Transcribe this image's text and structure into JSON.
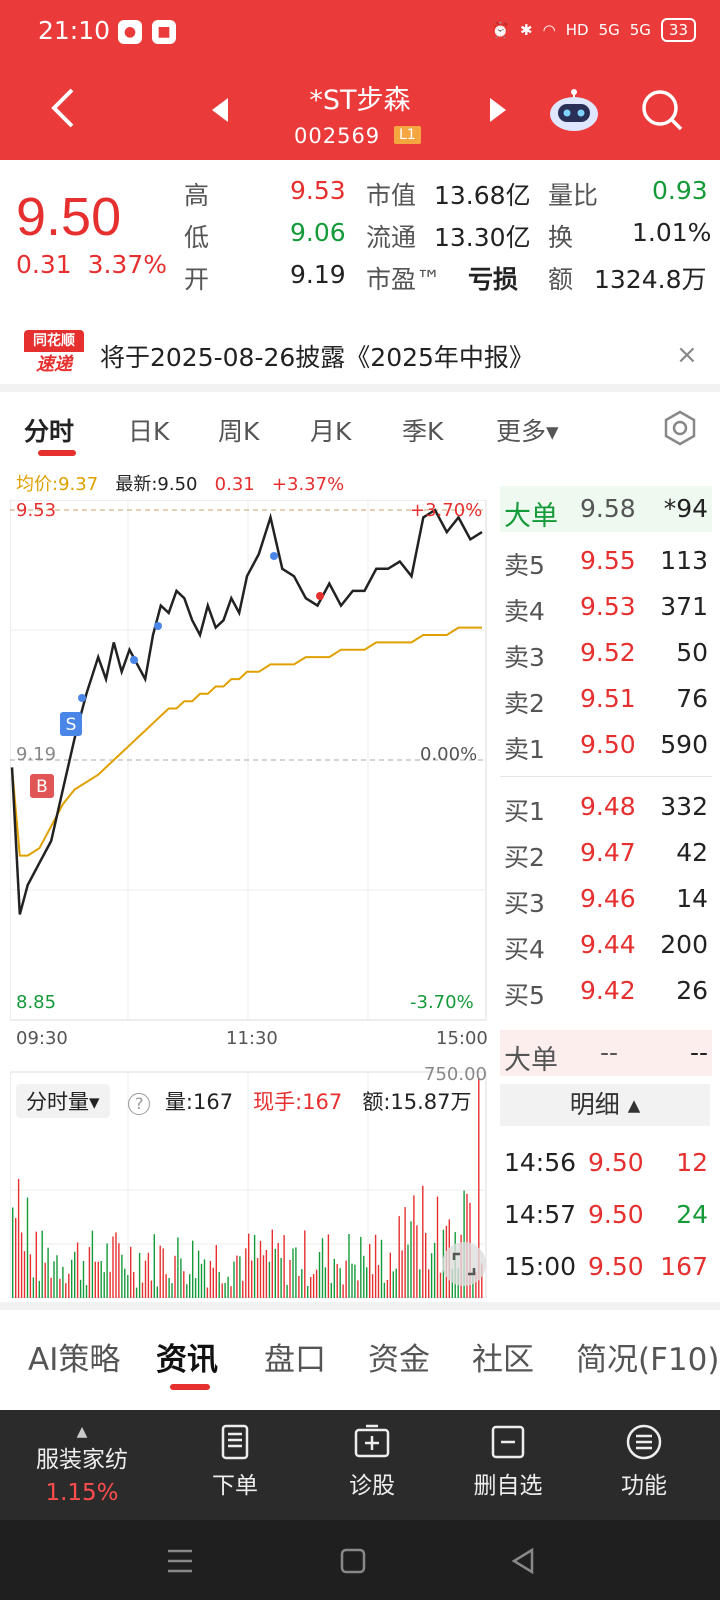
{
  "status": {
    "time": "21:10",
    "network": "5G",
    "hd": "HD",
    "battery": "33"
  },
  "header": {
    "title": "*ST步森",
    "code": "002569",
    "level": "L1"
  },
  "quote": {
    "price": "9.50",
    "change": "0.31",
    "change_pct": "3.37%",
    "high_label": "高",
    "high": "9.53",
    "low_label": "低",
    "low": "9.06",
    "open_label": "开",
    "open": "9.19",
    "mcap_label": "市值",
    "mcap": "13.68亿",
    "float_label": "流通",
    "float": "13.30亿",
    "pe_label": "市盈™",
    "pe": "亏损",
    "vr_label": "量比",
    "vr": "0.93",
    "turnover_label": "换",
    "turnover": "1.01%",
    "amount_label": "额",
    "amount": "1324.8万"
  },
  "notice": {
    "logo_top": "同花顺",
    "logo_bottom": "速递",
    "text": "将于2025-08-26披露《2025年中报》",
    "close": "×"
  },
  "chart_tabs": [
    {
      "label": "分时"
    },
    {
      "label": "日K"
    },
    {
      "label": "周K"
    },
    {
      "label": "月K"
    },
    {
      "label": "季K"
    },
    {
      "label": "更多▾"
    }
  ],
  "legend": {
    "avg": "均价:9.37",
    "latest": "最新:9.50",
    "chg": "0.31",
    "pct": "+3.37%"
  },
  "axes": {
    "top_price": "9.53",
    "top_pct": "+3.70%",
    "mid_price": "9.19",
    "mid_pct": "0.00%",
    "bot_price": "8.85",
    "bot_pct": "-3.70%",
    "t_start": "09:30",
    "t_mid": "11:30",
    "t_end": "15:00",
    "marker_b": "B",
    "marker_s": "S"
  },
  "chart_data": {
    "type": "line",
    "x_label_ticks": [
      "09:30",
      "11:30",
      "15:00"
    ],
    "ylim": [
      8.85,
      9.53
    ],
    "prev_close": 9.19,
    "series": [],
    "price_points_t": [
      0,
      4,
      8,
      14,
      20,
      26,
      32,
      38,
      44,
      48,
      52,
      56,
      60,
      64,
      68,
      72,
      76,
      80,
      84,
      88,
      92,
      96,
      100,
      104,
      108,
      112,
      116,
      120,
      126,
      132,
      138,
      144,
      150,
      156,
      162,
      168,
      174,
      180,
      186,
      192,
      198,
      204,
      210,
      216,
      222,
      228,
      234,
      240
    ],
    "price_points_y": [
      9.18,
      8.98,
      9.02,
      9.05,
      9.08,
      9.15,
      9.22,
      9.28,
      9.33,
      9.3,
      9.35,
      9.31,
      9.34,
      9.32,
      9.3,
      9.36,
      9.4,
      9.39,
      9.42,
      9.41,
      9.38,
      9.36,
      9.4,
      9.37,
      9.38,
      9.41,
      9.39,
      9.44,
      9.47,
      9.52,
      9.45,
      9.44,
      9.41,
      9.4,
      9.43,
      9.4,
      9.42,
      9.42,
      9.45,
      9.45,
      9.46,
      9.44,
      9.52,
      9.53,
      9.5,
      9.52,
      9.49,
      9.5
    ],
    "avg_points_y": [
      9.18,
      9.06,
      9.06,
      9.07,
      9.1,
      9.13,
      9.15,
      9.16,
      9.17,
      9.18,
      9.19,
      9.2,
      9.21,
      9.22,
      9.23,
      9.24,
      9.25,
      9.26,
      9.26,
      9.27,
      9.27,
      9.28,
      9.28,
      9.29,
      9.29,
      9.3,
      9.3,
      9.31,
      9.31,
      9.32,
      9.32,
      9.32,
      9.33,
      9.33,
      9.33,
      9.34,
      9.34,
      9.34,
      9.35,
      9.35,
      9.35,
      9.35,
      9.36,
      9.36,
      9.36,
      9.37,
      9.37,
      9.37
    ],
    "volume_max": 750
  },
  "book": {
    "big_label": "大单",
    "big_price": "9.58",
    "big_vol": "*94",
    "asks": [
      {
        "name": "卖5",
        "price": "9.55",
        "vol": "113"
      },
      {
        "name": "卖4",
        "price": "9.53",
        "vol": "371"
      },
      {
        "name": "卖3",
        "price": "9.52",
        "vol": "50"
      },
      {
        "name": "卖2",
        "price": "9.51",
        "vol": "76"
      },
      {
        "name": "卖1",
        "price": "9.50",
        "vol": "590"
      }
    ],
    "bids": [
      {
        "name": "买1",
        "price": "9.48",
        "vol": "332"
      },
      {
        "name": "买2",
        "price": "9.47",
        "vol": "42"
      },
      {
        "name": "买3",
        "price": "9.46",
        "vol": "14"
      },
      {
        "name": "买4",
        "price": "9.44",
        "vol": "200"
      },
      {
        "name": "买5",
        "price": "9.42",
        "vol": "26"
      }
    ],
    "big2_label": "大单",
    "big2_price": "--",
    "big2_vol": "--",
    "detail_label": "明细 ▴",
    "ticks": [
      {
        "time": "14:56",
        "price": "9.50",
        "vol": "12",
        "color": "#e5302f"
      },
      {
        "time": "14:57",
        "price": "9.50",
        "vol": "24",
        "color": "#159a3a"
      },
      {
        "time": "15:00",
        "price": "9.50",
        "vol": "167",
        "color": "#e5302f"
      }
    ]
  },
  "volume": {
    "selector": "分时量▾",
    "help": "?",
    "vol": "量:167",
    "now": "现手:167",
    "amount": "额:15.87万",
    "max_label": "750.00"
  },
  "info_tabs": [
    {
      "label": "AI策略"
    },
    {
      "label": "资讯"
    },
    {
      "label": "盘口"
    },
    {
      "label": "资金"
    },
    {
      "label": "社区"
    },
    {
      "label": "简况(F10)"
    }
  ],
  "bottom": {
    "sector": "服装家纺",
    "sector_pct": "1.15%",
    "order": "下单",
    "diag": "诊股",
    "del": "删自选",
    "func": "功能"
  },
  "colors": {
    "brand": "#ea3a3a",
    "up": "#e5302f",
    "down": "#159a3a",
    "avg_line": "#e0a100"
  }
}
